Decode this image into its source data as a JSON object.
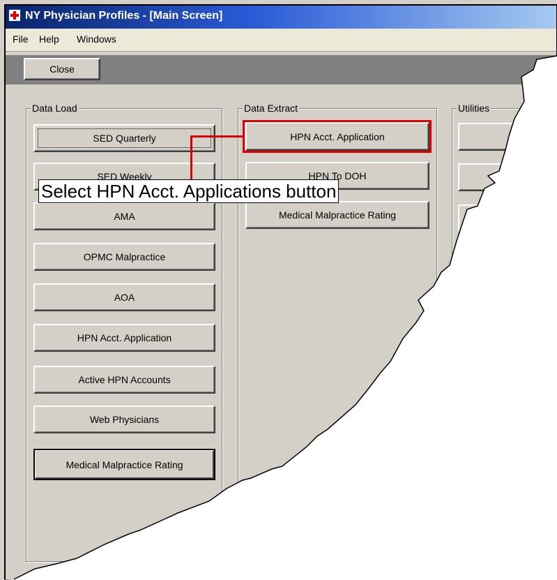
{
  "window": {
    "title": "NY Physician Profiles - [Main Screen]"
  },
  "menu": [
    {
      "label": "File"
    },
    {
      "label": "Help"
    },
    {
      "label": "Windows"
    }
  ],
  "toolbar": {
    "close_label": "Close"
  },
  "data_load": {
    "title": "Data Load",
    "buttons": [
      "SED Quarterly",
      "SED Weekly",
      "AMA",
      "OPMC Malpractice",
      "AOA",
      "HPN Acct. Application",
      "Active HPN Accounts",
      "Web Physicians",
      "Medical Malpractice Rating"
    ]
  },
  "data_extract": {
    "title": "Data Extract",
    "buttons": [
      "HPN Acct. Application",
      "HPN To DOH",
      "Medical Malpractice Rating"
    ]
  },
  "utilities": {
    "title": "Utilities",
    "buttons": [
      "",
      "",
      ""
    ]
  },
  "annotation": {
    "callout_text": "Select HPN Acct. Applications button",
    "color": "#e00000"
  },
  "colors": {
    "face": "#d4d0c8",
    "titlebar": "#0a246a"
  }
}
